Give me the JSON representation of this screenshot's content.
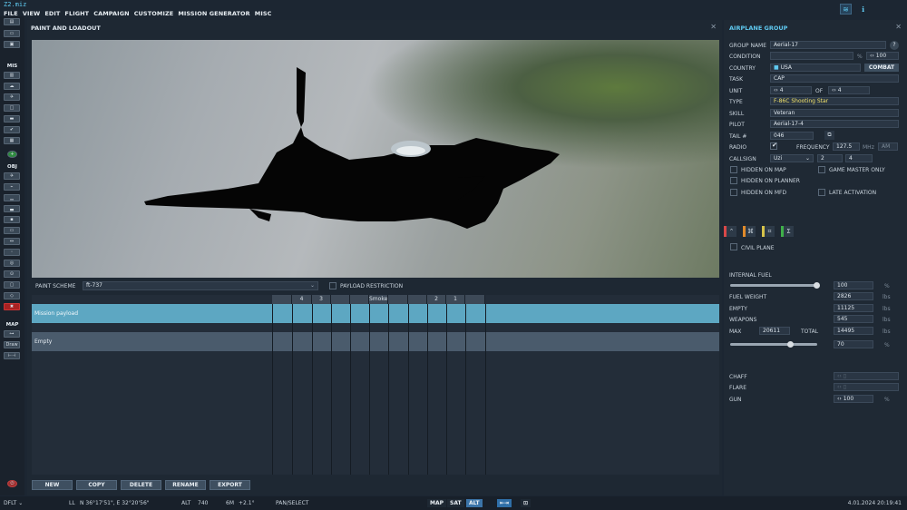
{
  "title": {
    "filename": "Z2.miz"
  },
  "menu": [
    "FILE",
    "VIEW",
    "EDIT",
    "FLIGHT",
    "CAMPAIGN",
    "CUSTOMIZE",
    "MISSION GENERATOR",
    "MISC"
  ],
  "left_toolbar": {
    "sections": [
      "MIS",
      "OBJ",
      "MAP"
    ],
    "draw_label": "Draw"
  },
  "paint_panel": {
    "header": "PAINT AND LOADOUT",
    "paint_scheme_label": "PAINT SCHEME",
    "paint_scheme_value": "ft-737",
    "payload_restriction_label": "PAYLOAD RESTRICTION",
    "stations": [
      "",
      "4",
      "3",
      "",
      "",
      "Smoke",
      "",
      "",
      "2",
      "1",
      ""
    ],
    "rows": [
      "Mission payload",
      "Empty"
    ],
    "buttons": [
      "NEW",
      "COPY",
      "DELETE",
      "RENAME",
      "EXPORT"
    ]
  },
  "group_panel": {
    "header": "AIRPLANE GROUP",
    "group_name_label": "GROUP NAME",
    "group_name": "Aerial-17",
    "condition_label": "CONDITION",
    "condition_unit": "%",
    "condition_value": "100",
    "country_label": "COUNTRY",
    "country_value": "USA",
    "combat_label": "COMBAT",
    "task_label": "TASK",
    "task_value": "CAP",
    "unit_label": "UNIT",
    "unit_value": "4",
    "of_label": "OF",
    "unit_of_value": "4",
    "type_label": "TYPE",
    "type_value": "F-86C Shooting Star",
    "skill_label": "SKILL",
    "skill_value": "Veteran",
    "pilot_label": "PILOT",
    "pilot_value": "Aerial-17-4",
    "tail_label": "TAIL #",
    "tail_value": "046",
    "radio_label": "RADIO",
    "frequency_label": "FREQUENCY",
    "frequency_value": "127.5",
    "freq_unit": "MHz",
    "modulation": "AM",
    "callsign_label": "CALLSIGN",
    "callsign_value": "Uzi",
    "callsign_n1": "2",
    "callsign_n2": "4",
    "hidden_on_map": "HIDDEN ON MAP",
    "game_master_only": "GAME MASTER ONLY",
    "hidden_on_planner": "HIDDEN ON PLANNER",
    "hidden_on_mfd": "HIDDEN ON MFD",
    "late_activation": "LATE ACTIVATION",
    "civil_plane": "CIVIL PLANE",
    "internal_fuel_label": "INTERNAL FUEL",
    "internal_fuel_value": "100",
    "pct": "%",
    "fuel_weight_label": "FUEL WEIGHT",
    "fuel_weight_value": "2826",
    "empty_label": "EMPTY",
    "empty_value": "11125",
    "weapons_label": "WEAPONS",
    "weapons_value": "545",
    "max_label": "MAX",
    "max_value": "20611",
    "total_label": "TOTAL",
    "total_value": "14495",
    "lbs": "lbs",
    "load_pct": "70",
    "chaff_label": "CHAFF",
    "flare_label": "FLARE",
    "gun_label": "GUN",
    "gun_value": "100"
  },
  "status": {
    "mode": "DFLT",
    "ll_label": "LL",
    "coords": "N 36°17'51\", E 32°20'56\"",
    "alt_label": "ALT",
    "alt_value": "740",
    "wind_label": "6M",
    "wind_value": "+2.1°",
    "tool": "PAN/SELECT",
    "map_btn": "MAP",
    "sat_btn": "SAT",
    "alt_btn": "ALT",
    "datetime": "4.01.2024 20:19:41"
  },
  "colors": {
    "accent": "#5fc9f0",
    "selected_row": "#5da7c2",
    "type_text": "#f2e36a"
  }
}
